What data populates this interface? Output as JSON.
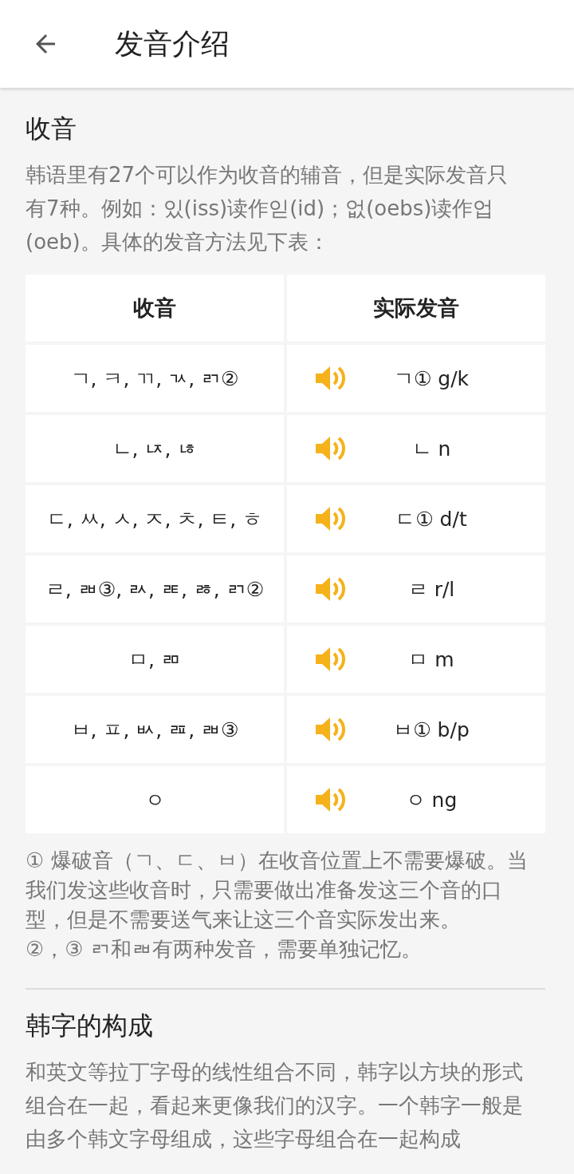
{
  "app_bar": {
    "title": "发音介绍"
  },
  "sections": [
    {
      "title": "收音",
      "paragraph": "韩语里有27个可以作为收音的辅音，但是实际发音只有7种。例如：있(iss)读作읻(id)；없(oebs)读作업(oeb)。具体的发音方法见下表：",
      "table": {
        "columns": [
          "收音",
          "实际发音"
        ],
        "rows": [
          {
            "finals": "ㄱ, ㅋ, ㄲ, ㄳ, ㄺ②",
            "sound": "ㄱ① g/k"
          },
          {
            "finals": "ㄴ, ㄵ, ㄶ",
            "sound": "ㄴ n"
          },
          {
            "finals": "ㄷ, ㅆ, ㅅ, ㅈ, ㅊ, ㅌ, ㅎ",
            "sound": "ㄷ① d/t"
          },
          {
            "finals": "ㄹ, ㄼ③, ㄽ, ㄾ, ㅀ, ㄺ②",
            "sound": "ㄹ r/l"
          },
          {
            "finals": "ㅁ, ㄻ",
            "sound": "ㅁ m"
          },
          {
            "finals": "ㅂ, ㅍ, ㅄ, ㄿ, ㄼ③",
            "sound": "ㅂ① b/p"
          },
          {
            "finals": "ㅇ",
            "sound": "ㅇ ng"
          }
        ]
      },
      "notes": [
        "① 爆破音（ㄱ、ㄷ、ㅂ）在收音位置上不需要爆破。当我们发这些收音时，只需要做出准备发这三个音的口型，但是不需要送气来让这三个音实际发出来。",
        "②，③ ㄺ和ㄼ有两种发音，需要单独记忆。"
      ]
    },
    {
      "title": "韩字的构成",
      "paragraph": "和英文等拉丁字母的线性组合不同，韩字以方块的形式组合在一起，看起来更像我们的汉字。一个韩字一般是由多个韩文字母组成，这些字母组合在一起构成"
    }
  ]
}
